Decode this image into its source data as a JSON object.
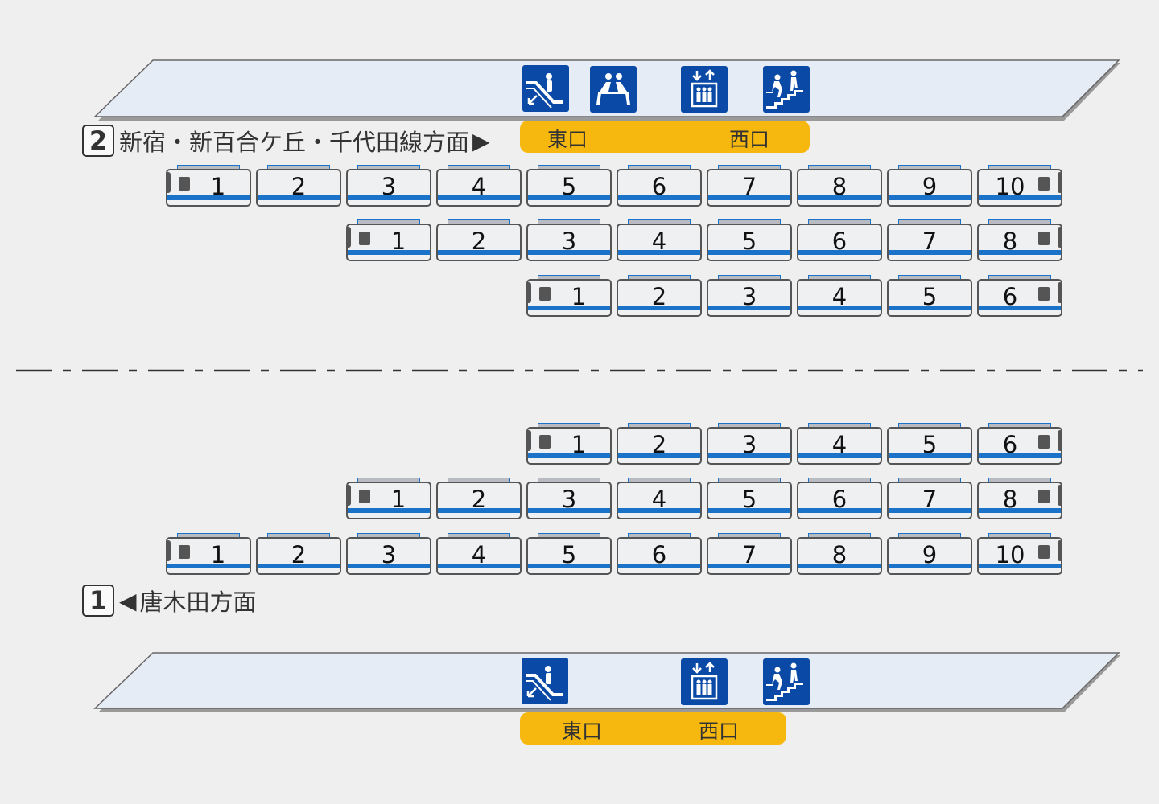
{
  "platform_top": {
    "facilities": [
      {
        "name": "escalator",
        "icon": "escalator-icon"
      },
      {
        "name": "waiting-seat",
        "icon": "bench-icon"
      },
      {
        "name": "elevator",
        "icon": "elevator-icon"
      },
      {
        "name": "stairs",
        "icon": "stairs-icon"
      }
    ],
    "exits": {
      "east": "東口",
      "west": "西口"
    }
  },
  "track2": {
    "number": "2",
    "direction": "新宿・新百合ケ丘・千代田線方面",
    "arrow": "▶",
    "formations": [
      {
        "cars": [
          "1",
          "2",
          "3",
          "4",
          "5",
          "6",
          "7",
          "8",
          "9",
          "10"
        ]
      },
      {
        "cars": [
          "1",
          "2",
          "3",
          "4",
          "5",
          "6",
          "7",
          "8"
        ]
      },
      {
        "cars": [
          "1",
          "2",
          "3",
          "4",
          "5",
          "6"
        ]
      }
    ]
  },
  "track1": {
    "number": "1",
    "direction": "唐木田方面",
    "arrow": "◀",
    "formations": [
      {
        "cars": [
          "1",
          "2",
          "3",
          "4",
          "5",
          "6"
        ]
      },
      {
        "cars": [
          "1",
          "2",
          "3",
          "4",
          "5",
          "6",
          "7",
          "8"
        ]
      },
      {
        "cars": [
          "1",
          "2",
          "3",
          "4",
          "5",
          "6",
          "7",
          "8",
          "9",
          "10"
        ]
      }
    ]
  },
  "platform_bottom": {
    "facilities": [
      {
        "name": "escalator",
        "icon": "escalator-icon"
      },
      {
        "name": "elevator",
        "icon": "elevator-icon"
      },
      {
        "name": "stairs",
        "icon": "stairs-icon"
      }
    ],
    "exits": {
      "east": "東口",
      "west": "西口"
    }
  },
  "colors": {
    "platform_fill": "#e5ecf5",
    "facility_blue": "#0a4aa6",
    "exit_yellow": "#f6b80f",
    "car_stripe": "#1a73c9"
  }
}
